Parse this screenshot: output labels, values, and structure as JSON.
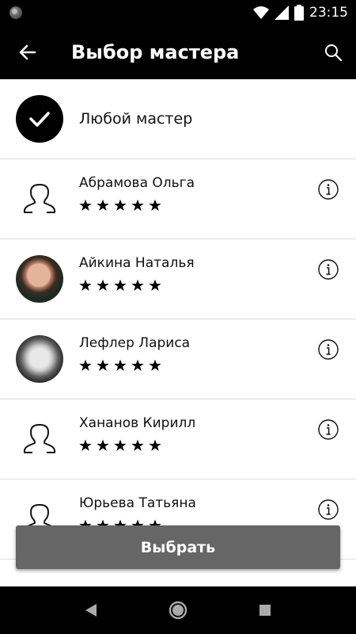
{
  "status_bar": {
    "time": "23:15"
  },
  "app_bar": {
    "title": "Выбор мастера"
  },
  "any_master": {
    "label": "Любой мастер"
  },
  "masters": [
    {
      "name": "Абрамова Ольга",
      "rating": 5,
      "avatar": "placeholder"
    },
    {
      "name": "Айкина Наталья",
      "rating": 5,
      "avatar": "photo"
    },
    {
      "name": "Лефлер Лариса",
      "rating": 5,
      "avatar": "photo"
    },
    {
      "name": "Хананов Кирилл",
      "rating": 5,
      "avatar": "placeholder"
    },
    {
      "name": "Юрьева Татьяна",
      "rating": 5,
      "avatar": "placeholder"
    }
  ],
  "select_button": {
    "label": "Выбрать"
  },
  "icons": {
    "back": "arrow-left-icon",
    "search": "search-icon",
    "check": "check-icon",
    "info": "info-icon",
    "person": "person-outline-icon",
    "star": "star-icon"
  },
  "colors": {
    "app_bar": "#000000",
    "button": "#666666",
    "divider": "#dedede"
  }
}
